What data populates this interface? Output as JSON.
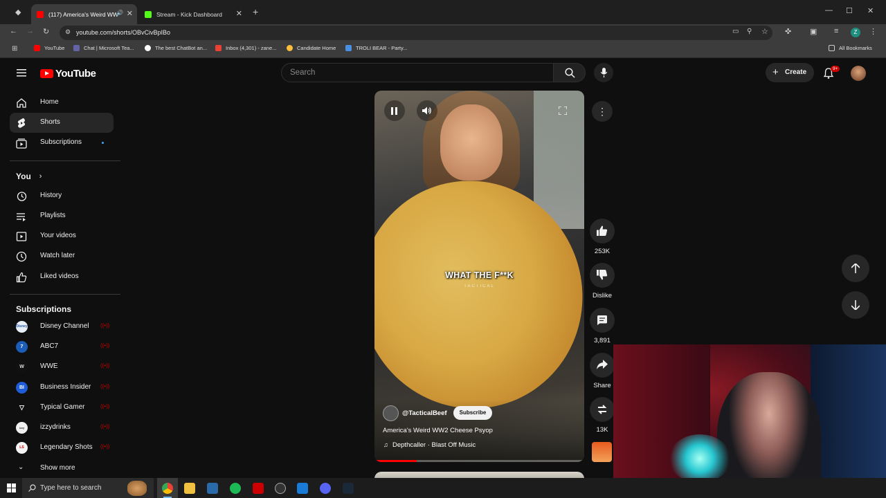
{
  "browser": {
    "tabs": [
      {
        "title": "(117) America's Weird WW2",
        "active": true
      },
      {
        "title": "Stream - Kick Dashboard",
        "active": false
      }
    ],
    "new_tab": "+",
    "url": "youtube.com/shorts/OBvCivBpIBo",
    "bookmarks": [
      "YouTube",
      "Chat | Microsoft Tea...",
      "The best ChatBot an...",
      "Inbox (4,301) - zane...",
      "Candidate Home",
      "TROLI BEAR - Party..."
    ],
    "all_bookmarks": "All Bookmarks",
    "profile_letter": "Z"
  },
  "youtube": {
    "logo_text": "YouTube",
    "search_placeholder": "Search",
    "create_label": "Create",
    "notif_badge": "9+",
    "nav": [
      {
        "label": "Home",
        "icon": "home-icon"
      },
      {
        "label": "Shorts",
        "icon": "shorts-icon"
      },
      {
        "label": "Subscriptions",
        "icon": "subscriptions-icon"
      }
    ],
    "you_label": "You",
    "you_items": [
      {
        "label": "History",
        "icon": "history-icon"
      },
      {
        "label": "Playlists",
        "icon": "playlists-icon"
      },
      {
        "label": "Your videos",
        "icon": "your-videos-icon"
      },
      {
        "label": "Watch later",
        "icon": "watch-later-icon"
      },
      {
        "label": "Liked videos",
        "icon": "liked-videos-icon"
      }
    ],
    "subscriptions_title": "Subscriptions",
    "subscriptions": [
      {
        "label": "Disney Channel",
        "color": "#e6eef8"
      },
      {
        "label": "ABC7",
        "color": "#1c5db8"
      },
      {
        "label": "WWE",
        "color": "#111111"
      },
      {
        "label": "Business Insider",
        "color": "#1f5dd6"
      },
      {
        "label": "Typical Gamer",
        "color": "#ffffff"
      },
      {
        "label": "izzydrinks",
        "color": "#f0f0f0"
      },
      {
        "label": "Legendary Shots",
        "color": "#f4f4f4"
      }
    ],
    "show_more": "Show more",
    "short": {
      "overlay_caption": "WHAT THE F**K",
      "overlay_sub": "TACTICAL",
      "channel": "@TacticalBeef",
      "subscribe": "Subscribe",
      "title": "America's Weird WW2 Cheese Psyop",
      "music": "Depthcaller · Blast Off Music",
      "likes": "253K",
      "dislike": "Dislike",
      "comments": "3,891",
      "share": "Share",
      "remix": "13K",
      "progress": 0.2
    }
  },
  "taskbar": {
    "search_placeholder": "Type here to search"
  },
  "colors": {
    "accent": "#ff0000",
    "background": "#0f0f0f"
  }
}
